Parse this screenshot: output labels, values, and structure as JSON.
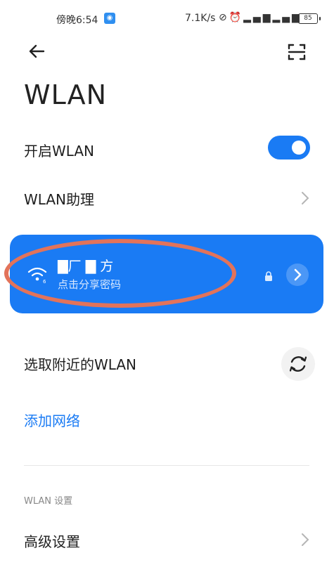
{
  "status_bar": {
    "time": "傍晚6:54",
    "net_speed": "7.1K/s",
    "battery": "85"
  },
  "header": {
    "title": "WLAN"
  },
  "toggle_row": {
    "label": "开启WLAN",
    "enabled": true
  },
  "assistant_row": {
    "label": "WLAN助理"
  },
  "connected_network": {
    "ssid": "‌▇厂 ▇ 方",
    "subtitle": "点击分享密码"
  },
  "nearby_row": {
    "label": "选取附近的WLAN"
  },
  "add_network": {
    "label": "添加网络"
  },
  "settings_section": {
    "header": "WLAN 设置"
  },
  "advanced_row": {
    "label": "高级设置"
  },
  "colors": {
    "accent": "#1a7bf4",
    "annotation": "#e2735a"
  },
  "icons": [
    "back-arrow-icon",
    "scan-icon",
    "wifi-icon",
    "lock-icon",
    "chevron-right-icon",
    "refresh-icon"
  ]
}
